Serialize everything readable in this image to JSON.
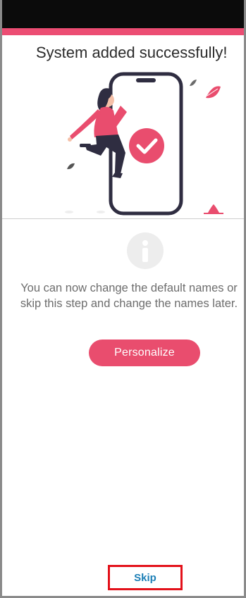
{
  "header": {
    "title": "System added successfully!"
  },
  "hero": {
    "illustration": "woman-jumping-with-phone-checkmark",
    "check_icon": "check-circle-icon",
    "accent_color": "#e94d6e"
  },
  "info": {
    "icon": "info-icon",
    "line1": "You can now change the default names or",
    "line2": "skip this step and change the names later."
  },
  "actions": {
    "personalize_label": "Personalize",
    "skip_label": "Skip"
  },
  "colors": {
    "accent": "#e94d6e",
    "link": "#1c7fb6",
    "highlight_border": "#e3111a"
  }
}
